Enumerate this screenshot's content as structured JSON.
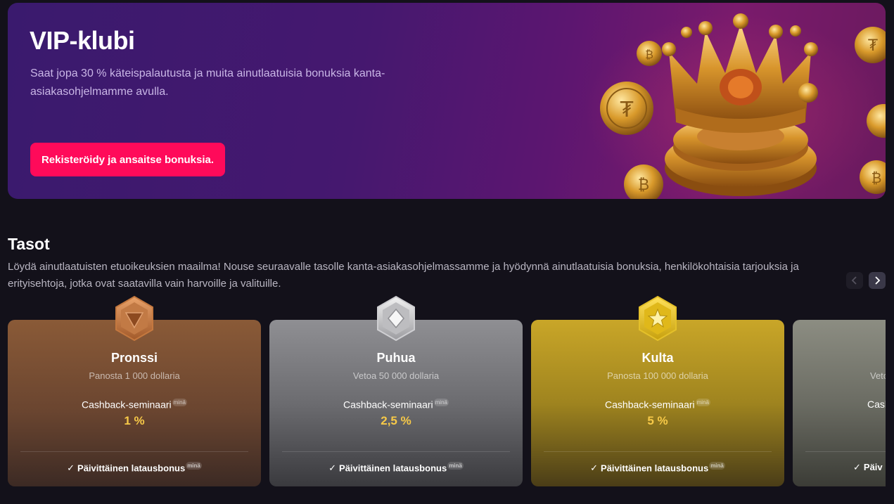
{
  "hero": {
    "title": "VIP-klubi",
    "description": "Saat jopa 30 % käteispalautusta ja muita ainutlaatuisia bonuksia kanta-asiakasohjelmamme avulla.",
    "cta_label": "Rekisteröidy ja ansaitse bonuksia."
  },
  "tiers_section": {
    "title": "Tasot",
    "description": "Löydä ainutlaatuisten etuoikeuksien maailma! Nouse seuraavalle tasolle kanta-asiakasohjelmassamme ja hyödynnä ainutlaatuisia bonuksia, henkilökohtaisia tarjouksia ja erityisehtoja, jotka ovat saatavilla vain harvoille ja valituille.",
    "prev_icon": "chevron-left-icon",
    "next_icon": "chevron-right-icon"
  },
  "tiers": [
    {
      "name": "Pronssi",
      "requirement": "Panosta 1 000 dollaria",
      "cashback_label": "Cashback-seminaari",
      "cashback_tag": "minä",
      "cashback_value": "1 %",
      "bonus_label": "Päivittäinen latausbonus",
      "bonus_tag": "minä",
      "icon": "bronze-badge-icon",
      "color": "#8a5a37"
    },
    {
      "name": "Puhua",
      "requirement": "Vetoa 50 000 dollaria",
      "cashback_label": "Cashback-seminaari",
      "cashback_tag": "minä",
      "cashback_value": "2,5 %",
      "bonus_label": "Päivittäinen latausbonus",
      "bonus_tag": "minä",
      "icon": "silver-badge-icon",
      "color": "#8f8f93"
    },
    {
      "name": "Kulta",
      "requirement": "Panosta 100 000 dollaria",
      "cashback_label": "Cashback-seminaari",
      "cashback_tag": "minä",
      "cashback_value": "5 %",
      "bonus_label": "Päivittäinen latausbonus",
      "bonus_tag": "minä",
      "icon": "gold-badge-icon",
      "color": "#c9a628"
    },
    {
      "requirement_partial": "Vetc",
      "cashback_label_partial": "Cash",
      "bonus_label_partial": "Päiv",
      "color": "#8c8d82"
    }
  ],
  "colors": {
    "accent": "#ff0a5a",
    "cashback_value": "#f7c948",
    "background": "#13111a"
  }
}
